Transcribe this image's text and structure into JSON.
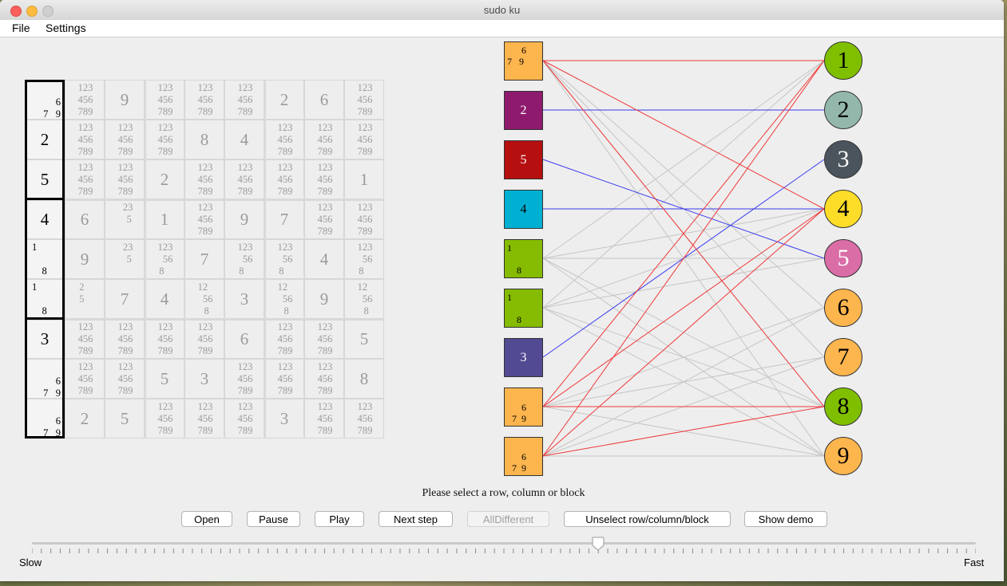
{
  "window": {
    "title": "sudo ku"
  },
  "menu": {
    "file": "File",
    "settings": "Settings"
  },
  "sudoku": {
    "rows": [
      [
        "7 9 / 6",
        "123\n456\n789",
        "9",
        "123\n456\n789",
        "123\n456\n789",
        "123\n456\n789",
        "2",
        "6",
        "123\n456\n789"
      ],
      [
        "2",
        "123\n456\n789",
        "123\n456\n789",
        "123\n456\n789",
        "8",
        "4",
        "123\n456\n789",
        "123\n456\n789",
        "123\n456\n789"
      ],
      [
        "5",
        "123\n456\n789",
        "123\n456\n789",
        "2",
        "123\n456\n789",
        "123\n456\n789",
        "123\n456\n789",
        "123\n456\n789",
        "1"
      ],
      [
        "4",
        "6",
        "  23\n   5",
        "1",
        "123\n456\n789",
        "9",
        "7",
        "123\n456\n789",
        "123\n456\n789"
      ],
      [
        "1 8",
        "9",
        "  23\n   5",
        "123\n  56\n8   ",
        "7",
        "123\n  56\n8   ",
        "123\n  56\n8   ",
        "4",
        "123\n  56\n8   "
      ],
      [
        "1 8",
        "2   \n5   ",
        "7",
        "4",
        "12  \n  56\n  8 ",
        "3",
        "12  \n  56\n  8 ",
        "9",
        "12  \n  56\n  8 "
      ],
      [
        "3",
        "123\n456\n789",
        "123\n456\n789",
        "123\n456\n789",
        "123\n456\n789",
        "6",
        "123\n456\n789",
        "123\n456\n789",
        "5"
      ],
      [
        "7 9 / 6",
        "123\n456\n789",
        "123\n456\n789",
        "5",
        "3",
        "123\n456\n789",
        "123\n456\n789",
        "123\n456\n789",
        "8"
      ],
      [
        "7 9 / 6",
        "2",
        "5",
        "123\n456\n789",
        "123\n456\n789",
        "123\n456\n789",
        "3",
        "123\n456\n789",
        "123\n456\n789"
      ]
    ]
  },
  "graph": {
    "cells": [
      {
        "label": "",
        "cand": "      6\n7   9",
        "color": "#fdb54e"
      },
      {
        "label": "2",
        "cand": "",
        "color": "#8e1a6e"
      },
      {
        "label": "5",
        "cand": "",
        "color": "#b5100f"
      },
      {
        "label": "4",
        "cand": "",
        "color": "#00b0d3",
        "dark": true
      },
      {
        "label": "",
        "cand": "1\n\n    8",
        "color": "#85bb00"
      },
      {
        "label": "",
        "cand": "1\n\n    8",
        "color": "#85bb00"
      },
      {
        "label": "3",
        "cand": "",
        "color": "#524a92"
      },
      {
        "label": "",
        "cand": "\n      6\n  7  9",
        "color": "#fdb54e"
      },
      {
        "label": "",
        "cand": "\n      6\n  7  9",
        "color": "#fdb54e"
      }
    ],
    "values": [
      {
        "label": "1",
        "color": "#7fbf00",
        "text": "#000"
      },
      {
        "label": "2",
        "color": "#93b7ab",
        "text": "#000"
      },
      {
        "label": "3",
        "color": "#4b545c",
        "text": "#fff"
      },
      {
        "label": "4",
        "color": "#fddd28",
        "text": "#000"
      },
      {
        "label": "5",
        "color": "#da6ca6",
        "text": "#fff"
      },
      {
        "label": "6",
        "color": "#fdb54e",
        "text": "#000"
      },
      {
        "label": "7",
        "color": "#fdb54e",
        "text": "#000"
      },
      {
        "label": "8",
        "color": "#7fbf00",
        "text": "#000"
      },
      {
        "label": "9",
        "color": "#fdb54e",
        "text": "#000"
      }
    ]
  },
  "status": "Please select a row, column or block",
  "buttons": {
    "open": "Open",
    "pause": "Pause",
    "play": "Play",
    "next_step": "Next step",
    "all_different": "AllDifferent",
    "unselect": "Unselect row/column/block",
    "show_demo": "Show demo"
  },
  "slider": {
    "slow": "Slow",
    "fast": "Fast",
    "value": 0.6
  }
}
